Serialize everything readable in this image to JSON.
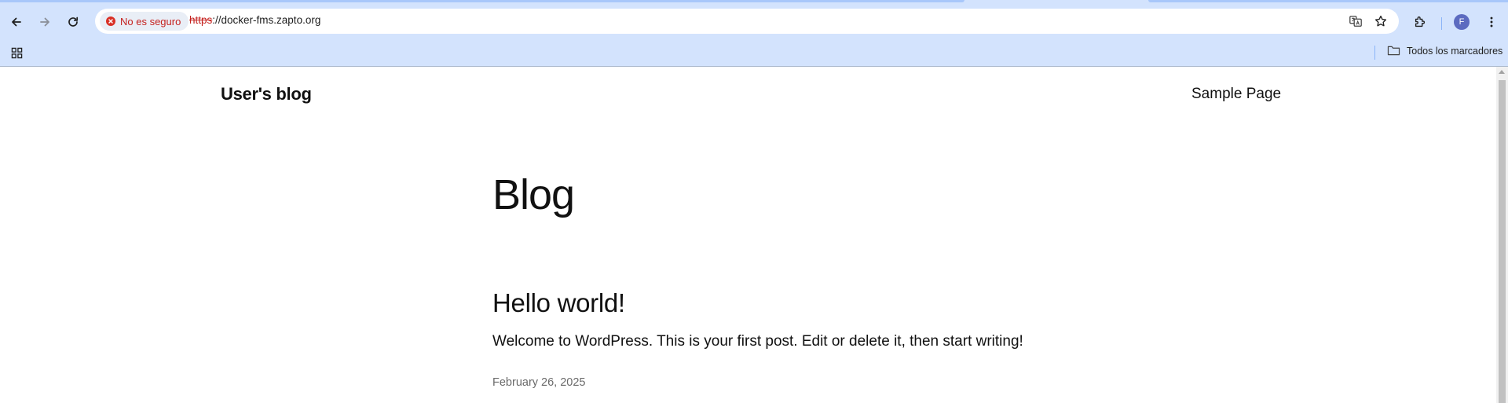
{
  "browser": {
    "security_label": "No es seguro",
    "url_scheme": "https",
    "url_rest": "://docker-fms.zapto.org",
    "profile_initial": "F",
    "bookmarks_all_label": "Todos los marcadores",
    "icons": {
      "back": "arrow-left-icon",
      "forward": "arrow-right-icon",
      "reload": "reload-icon",
      "translate": "translate-icon",
      "bookmark": "star-icon",
      "extensions": "puzzle-icon",
      "menu": "kebab-menu-icon",
      "apps": "apps-grid-icon",
      "folder": "folder-icon"
    },
    "colors": {
      "chrome_bg": "#d3e3fd",
      "warning": "#c5221f",
      "avatar": "#5c6bc0"
    }
  },
  "site": {
    "title": "User's blog",
    "nav": [
      "Sample Page"
    ]
  },
  "main": {
    "heading": "Blog",
    "posts": [
      {
        "title": "Hello world!",
        "excerpt": "Welcome to WordPress. This is your first post. Edit or delete it, then start writing!",
        "date": "February 26, 2025"
      }
    ]
  }
}
